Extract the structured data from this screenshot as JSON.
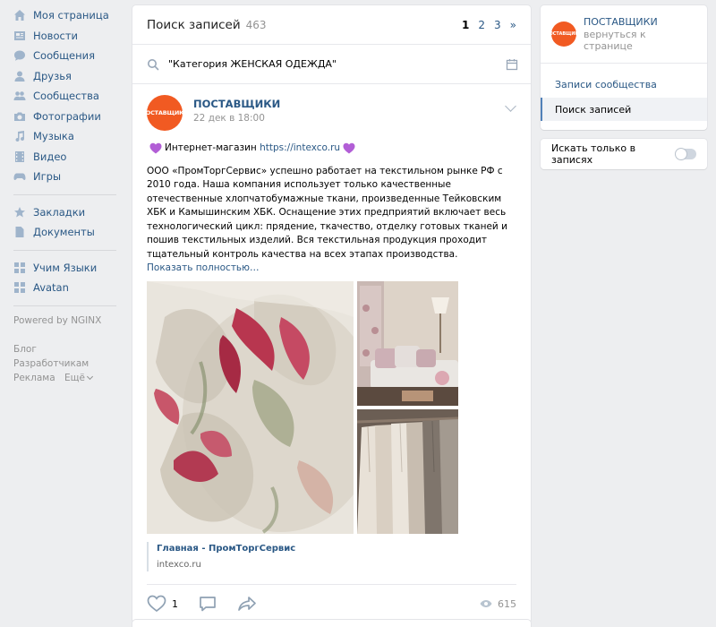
{
  "leftnav": {
    "items": [
      {
        "label": "Моя страница",
        "icon": "home-icon"
      },
      {
        "label": "Новости",
        "icon": "news-icon"
      },
      {
        "label": "Сообщения",
        "icon": "messages-icon"
      },
      {
        "label": "Друзья",
        "icon": "friends-icon"
      },
      {
        "label": "Сообщества",
        "icon": "communities-icon"
      },
      {
        "label": "Фотографии",
        "icon": "photos-icon"
      },
      {
        "label": "Музыка",
        "icon": "music-icon"
      },
      {
        "label": "Видео",
        "icon": "video-icon"
      },
      {
        "label": "Игры",
        "icon": "games-icon"
      }
    ],
    "items2": [
      {
        "label": "Закладки",
        "icon": "bookmarks-icon"
      },
      {
        "label": "Документы",
        "icon": "documents-icon"
      }
    ],
    "apps": [
      {
        "label": "Учим Языки",
        "icon": "app-icon"
      },
      {
        "label": "Avatan",
        "icon": "app-icon"
      }
    ],
    "powered": "Powered by NGINX",
    "footer": {
      "blog": "Блог",
      "developers": "Разработчикам",
      "ads": "Реклама",
      "more": "Ещё"
    }
  },
  "search": {
    "title": "Поиск записей",
    "count": "463",
    "pages": [
      "1",
      "2",
      "3",
      "»"
    ],
    "query": "\"Категория ЖЕНСКАЯ ОДЕЖДА\""
  },
  "post": {
    "avatar_text": "ПОСТАВЩИКИ",
    "author": "ПОСТАВЩИКИ",
    "date": "22 дек в 18:00",
    "shop_label": "Интернет-магазин",
    "shop_link": "https://intexco.ru",
    "body": "ООО «ПромТоргСервис» успешно работает на текстильном рынке РФ с 2010 года. Наша компания использует только качественные отечественные хлопчатобумажные ткани, произведенные Тейковским ХБК и Камышинским ХБК. Оснащение этих предприятий включает весь технологический цикл: прядение, ткачество, отделку готовых тканей и пошив текстильных изделий. Вся текстильная продукция проходит тщательный контроль качества на всех этапах производства.",
    "show_more": "Показать полностью…",
    "link_title": "Главная - ПромТоргСервис",
    "link_url": "intexco.ru",
    "likes": "1",
    "views": "615"
  },
  "right": {
    "group_avatar_text": "ПОСТАВЩИКИ",
    "group_name": "ПОСТАВЩИКИ",
    "group_back": "вернуться к странице",
    "menu": [
      "Записи сообщества",
      "Поиск записей"
    ],
    "toggle_label": "Искать только в записях"
  },
  "colors": {
    "link": "#2a5885",
    "accent": "#5181b8",
    "avatar": "#f15a22",
    "heart": "#b25ed6",
    "background": "#edeef0"
  }
}
